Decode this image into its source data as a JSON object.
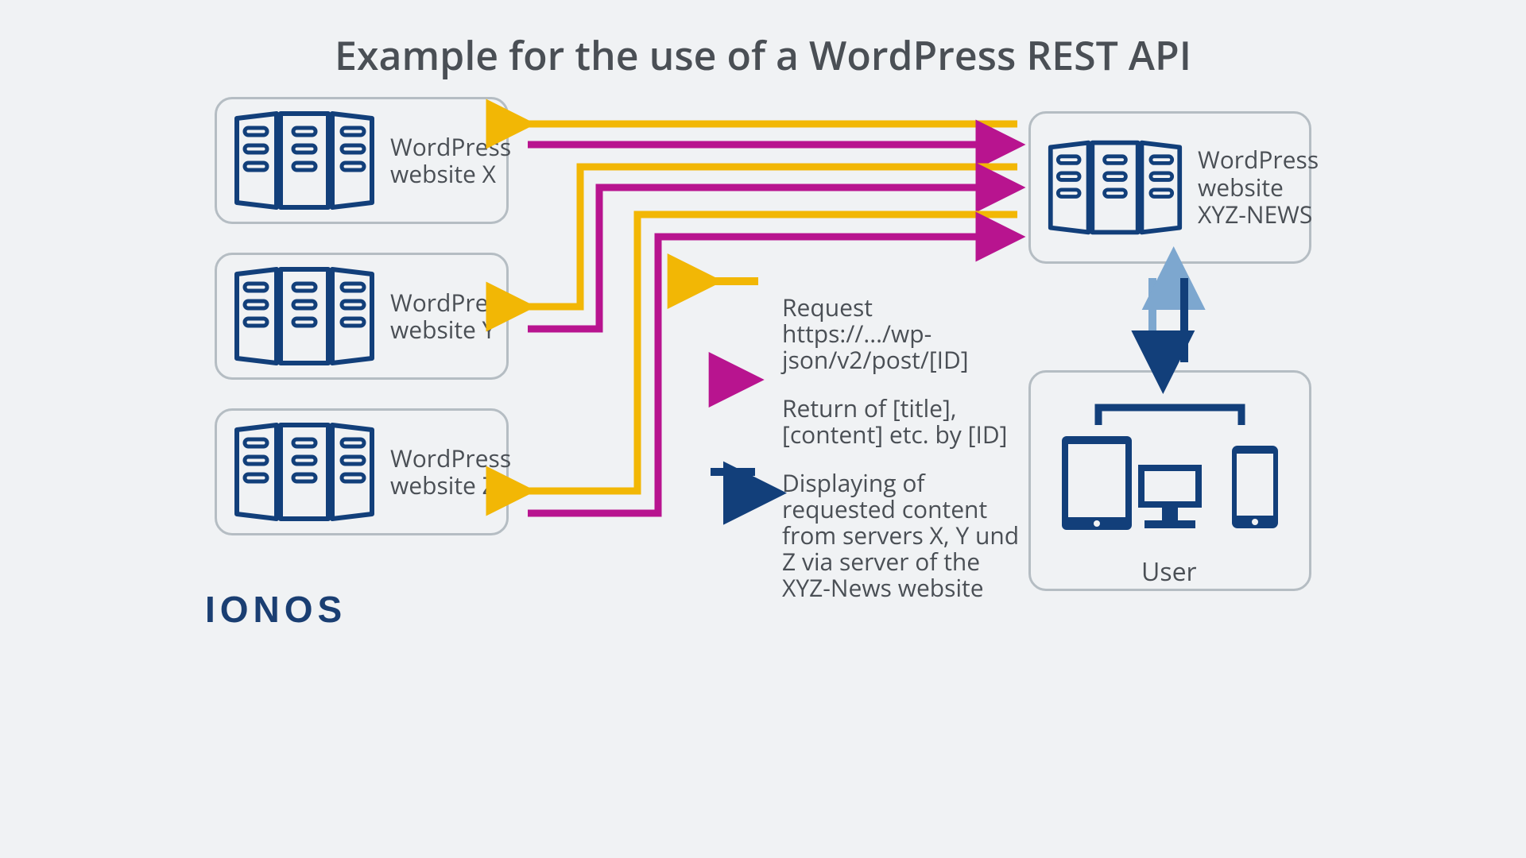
{
  "title": "Example for the use of a WordPress REST API",
  "servers": {
    "x": "WordPress website X",
    "y": "WordPress website Y",
    "z": "WordPress website Z",
    "news": "WordPress website XYZ-NEWS"
  },
  "legend": {
    "request_title": "Request",
    "request_url": "https://.../wp-json/v2/post/[ID]",
    "return_text": "Return of [title], [content] etc. by [ID]",
    "display_text": "Displaying of requested content from servers X, Y und Z via server of the XYZ-News website"
  },
  "user_label": "User",
  "brand": "IONOS",
  "colors": {
    "yellow": "#f2b705",
    "magenta": "#b8148f",
    "darkblue": "#123f7a",
    "lightblue": "#7da7cf",
    "gray": "#4a4f55"
  }
}
